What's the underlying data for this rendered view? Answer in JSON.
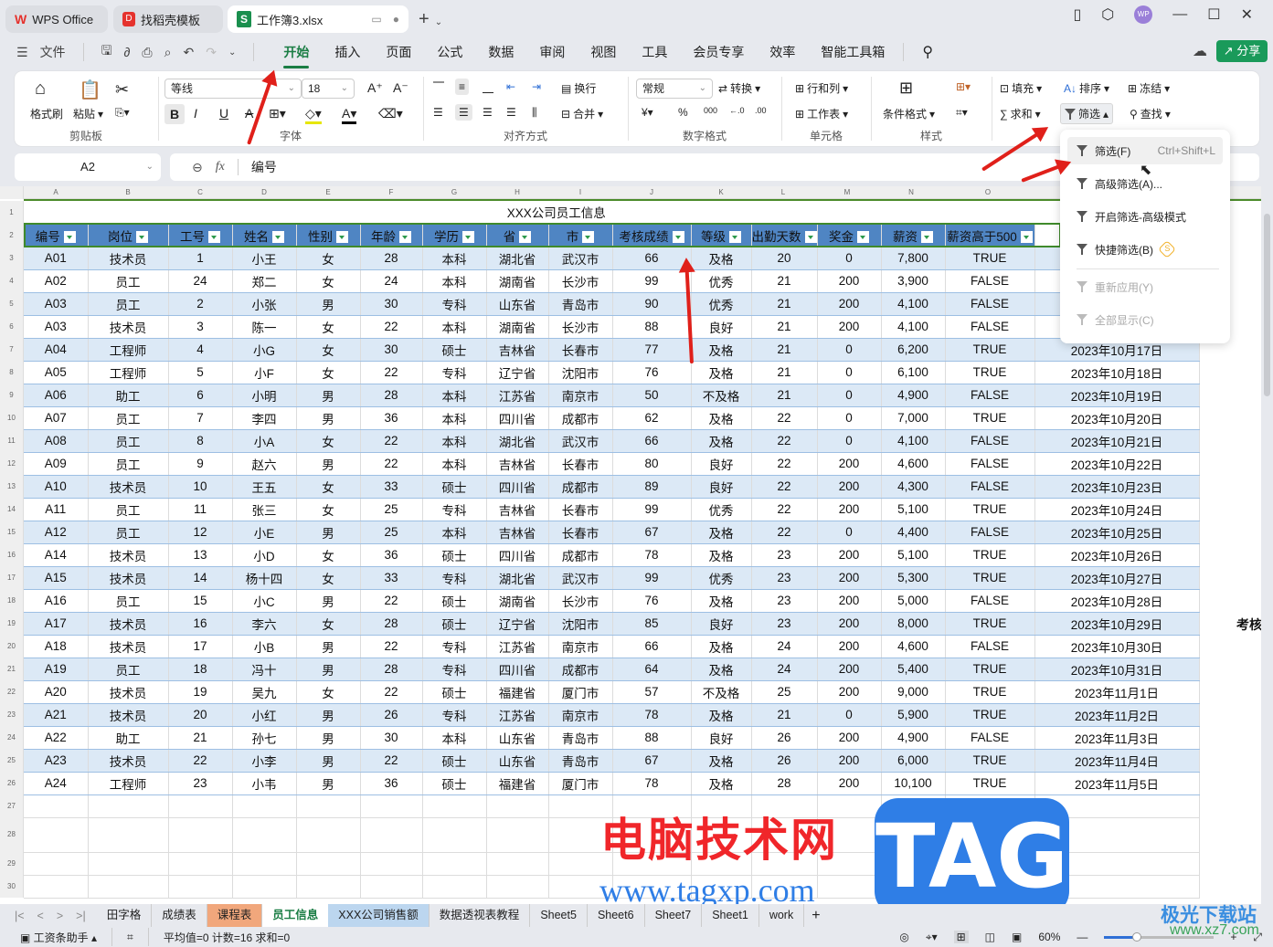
{
  "titlebar": {
    "tabs": [
      {
        "label": "WPS Office",
        "icon": "wps-logo-icon"
      },
      {
        "label": "找稻壳模板",
        "icon": "docer-icon"
      },
      {
        "label": "工作簿3.xlsx",
        "icon": "spreadsheet-icon"
      }
    ],
    "avatar": "WP"
  },
  "menubar": {
    "file": "文件",
    "items": [
      "开始",
      "插入",
      "页面",
      "公式",
      "数据",
      "审阅",
      "视图",
      "工具",
      "会员专享",
      "效率",
      "智能工具箱"
    ],
    "active": "开始",
    "share": "分享"
  },
  "ribbon": {
    "clipboard": {
      "format_painter": "格式刷",
      "paste": "粘贴",
      "label": "剪贴板"
    },
    "font": {
      "name": "等线",
      "size": "18",
      "label": "字体"
    },
    "align": {
      "wrap": "换行",
      "merge": "合并",
      "label": "对齐方式"
    },
    "number": {
      "format": "常规",
      "convert": "转换",
      "label": "数字格式"
    },
    "cells": {
      "rowcol": "行和列",
      "sheet": "工作表",
      "label": "单元格"
    },
    "styles": {
      "cond_format": "条件格式",
      "label": "样式"
    },
    "edit": {
      "fill": "填充",
      "sort": "排序",
      "freeze": "冻结",
      "sum": "求和",
      "filter": "筛选",
      "find": "查找"
    }
  },
  "formula_bar": {
    "cell_ref": "A2",
    "fx": "fx",
    "value": "编号"
  },
  "columns": [
    "A",
    "B",
    "C",
    "D",
    "E",
    "F",
    "G",
    "H",
    "I",
    "J",
    "K",
    "L",
    "M",
    "N",
    "O"
  ],
  "sheet": {
    "title": "XXX公司员工信息",
    "headers": [
      "编号",
      "岗位",
      "工号",
      "姓名",
      "性别",
      "年龄",
      "学历",
      "省",
      "市",
      "考核成绩",
      "等级",
      "出勤天数",
      "奖金",
      "薪资",
      "薪资高于500"
    ],
    "rows": [
      [
        "A01",
        "技术员",
        "1",
        "小王",
        "女",
        "28",
        "本科",
        "湖北省",
        "武汉市",
        "66",
        "及格",
        "20",
        "0",
        "7,800",
        "TRUE",
        ""
      ],
      [
        "A02",
        "员工",
        "24",
        "郑二",
        "女",
        "24",
        "本科",
        "湖南省",
        "长沙市",
        "99",
        "优秀",
        "21",
        "200",
        "3,900",
        "FALSE",
        ""
      ],
      [
        "A03",
        "员工",
        "2",
        "小张",
        "男",
        "30",
        "专科",
        "山东省",
        "青岛市",
        "90",
        "优秀",
        "21",
        "200",
        "4,100",
        "FALSE",
        ""
      ],
      [
        "A03",
        "技术员",
        "3",
        "陈一",
        "女",
        "22",
        "本科",
        "湖南省",
        "长沙市",
        "88",
        "良好",
        "21",
        "200",
        "4,100",
        "FALSE",
        ""
      ],
      [
        "A04",
        "工程师",
        "4",
        "小G",
        "女",
        "30",
        "硕士",
        "吉林省",
        "长春市",
        "77",
        "及格",
        "21",
        "0",
        "6,200",
        "TRUE",
        "2023年10月17日"
      ],
      [
        "A05",
        "工程师",
        "5",
        "小F",
        "女",
        "22",
        "专科",
        "辽宁省",
        "沈阳市",
        "76",
        "及格",
        "21",
        "0",
        "6,100",
        "TRUE",
        "2023年10月18日"
      ],
      [
        "A06",
        "助工",
        "6",
        "小明",
        "男",
        "28",
        "本科",
        "江苏省",
        "南京市",
        "50",
        "不及格",
        "21",
        "0",
        "4,900",
        "FALSE",
        "2023年10月19日"
      ],
      [
        "A07",
        "员工",
        "7",
        "李四",
        "男",
        "36",
        "本科",
        "四川省",
        "成都市",
        "62",
        "及格",
        "22",
        "0",
        "7,000",
        "TRUE",
        "2023年10月20日"
      ],
      [
        "A08",
        "员工",
        "8",
        "小A",
        "女",
        "22",
        "本科",
        "湖北省",
        "武汉市",
        "66",
        "及格",
        "22",
        "0",
        "4,100",
        "FALSE",
        "2023年10月21日"
      ],
      [
        "A09",
        "员工",
        "9",
        "赵六",
        "男",
        "22",
        "本科",
        "吉林省",
        "长春市",
        "80",
        "良好",
        "22",
        "200",
        "4,600",
        "FALSE",
        "2023年10月22日"
      ],
      [
        "A10",
        "技术员",
        "10",
        "王五",
        "女",
        "33",
        "硕士",
        "四川省",
        "成都市",
        "89",
        "良好",
        "22",
        "200",
        "4,300",
        "FALSE",
        "2023年10月23日"
      ],
      [
        "A11",
        "员工",
        "11",
        "张三",
        "女",
        "25",
        "专科",
        "吉林省",
        "长春市",
        "99",
        "优秀",
        "22",
        "200",
        "5,100",
        "TRUE",
        "2023年10月24日"
      ],
      [
        "A12",
        "员工",
        "12",
        "小E",
        "男",
        "25",
        "本科",
        "吉林省",
        "长春市",
        "67",
        "及格",
        "22",
        "0",
        "4,400",
        "FALSE",
        "2023年10月25日"
      ],
      [
        "A14",
        "技术员",
        "13",
        "小D",
        "女",
        "36",
        "硕士",
        "四川省",
        "成都市",
        "78",
        "及格",
        "23",
        "200",
        "5,100",
        "TRUE",
        "2023年10月26日"
      ],
      [
        "A15",
        "技术员",
        "14",
        "杨十四",
        "女",
        "33",
        "专科",
        "湖北省",
        "武汉市",
        "99",
        "优秀",
        "23",
        "200",
        "5,300",
        "TRUE",
        "2023年10月27日"
      ],
      [
        "A16",
        "员工",
        "15",
        "小C",
        "男",
        "22",
        "硕士",
        "湖南省",
        "长沙市",
        "76",
        "及格",
        "23",
        "200",
        "5,000",
        "FALSE",
        "2023年10月28日"
      ],
      [
        "A17",
        "技术员",
        "16",
        "李六",
        "女",
        "28",
        "硕士",
        "辽宁省",
        "沈阳市",
        "85",
        "良好",
        "23",
        "200",
        "8,000",
        "TRUE",
        "2023年10月29日"
      ],
      [
        "A18",
        "技术员",
        "17",
        "小B",
        "男",
        "22",
        "专科",
        "江苏省",
        "南京市",
        "66",
        "及格",
        "24",
        "200",
        "4,600",
        "FALSE",
        "2023年10月30日"
      ],
      [
        "A19",
        "员工",
        "18",
        "冯十",
        "男",
        "28",
        "专科",
        "四川省",
        "成都市",
        "64",
        "及格",
        "24",
        "200",
        "5,400",
        "TRUE",
        "2023年10月31日"
      ],
      [
        "A20",
        "技术员",
        "19",
        "吴九",
        "女",
        "22",
        "硕士",
        "福建省",
        "厦门市",
        "57",
        "不及格",
        "25",
        "200",
        "9,000",
        "TRUE",
        "2023年11月1日"
      ],
      [
        "A21",
        "技术员",
        "20",
        "小红",
        "男",
        "26",
        "专科",
        "江苏省",
        "南京市",
        "78",
        "及格",
        "21",
        "0",
        "5,900",
        "TRUE",
        "2023年11月2日"
      ],
      [
        "A22",
        "助工",
        "21",
        "孙七",
        "男",
        "30",
        "本科",
        "山东省",
        "青岛市",
        "88",
        "良好",
        "26",
        "200",
        "4,900",
        "FALSE",
        "2023年11月3日"
      ],
      [
        "A23",
        "技术员",
        "22",
        "小李",
        "男",
        "22",
        "硕士",
        "山东省",
        "青岛市",
        "67",
        "及格",
        "26",
        "200",
        "6,000",
        "TRUE",
        "2023年11月4日"
      ],
      [
        "A24",
        "工程师",
        "23",
        "小韦",
        "男",
        "36",
        "硕士",
        "福建省",
        "厦门市",
        "78",
        "及格",
        "28",
        "200",
        "10,100",
        "TRUE",
        "2023年11月5日"
      ]
    ],
    "side_text": "考核"
  },
  "filter_menu": {
    "items": [
      {
        "label": "筛选(F)",
        "shortcut": "Ctrl+Shift+L",
        "state": "hover"
      },
      {
        "label": "高级筛选(A)...",
        "state": "normal"
      },
      {
        "label": "开启筛选-高级模式",
        "state": "normal"
      },
      {
        "label": "快捷筛选(B)",
        "state": "normal",
        "badge": "S"
      },
      {
        "label": "重新应用(Y)",
        "state": "disabled"
      },
      {
        "label": "全部显示(C)",
        "state": "disabled"
      }
    ]
  },
  "sheet_tabs": [
    "田字格",
    "成绩表",
    "课程表",
    "员工信息",
    "XXX公司销售额",
    "数据透视表教程",
    "Sheet5",
    "Sheet6",
    "Sheet7",
    "Sheet1",
    "work"
  ],
  "active_sheet": "员工信息",
  "status": {
    "helper": "工资条助手",
    "stats": "平均值=0  计数=16  求和=0",
    "zoom": "60%",
    "zoom_fraction": 0.3
  },
  "watermarks": {
    "cn": "电脑技术网",
    "url": "www.tagxp.com",
    "tag": "TAG",
    "site2": "极光下载站",
    "url2": "www.xz7.com"
  }
}
